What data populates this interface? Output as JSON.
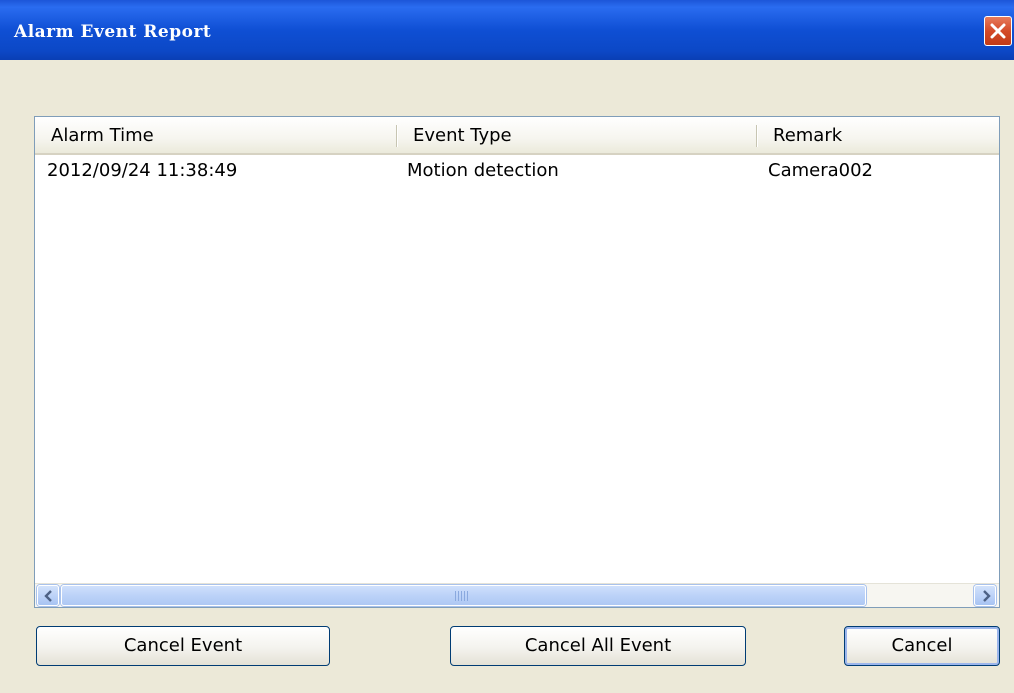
{
  "window": {
    "title": "Alarm Event Report",
    "close_icon": "close-icon",
    "close_color": "#d44a28",
    "title_bar_color": "#0f4fd4"
  },
  "table": {
    "columns": [
      "Alarm Time",
      "Event Type",
      "Remark"
    ],
    "rows": [
      {
        "alarm_time": "2012/09/24 11:38:49",
        "event_type": "Motion detection",
        "remark": "Camera002"
      }
    ]
  },
  "scrollbar": {
    "left_icon": "chevron-left-icon",
    "right_icon": "chevron-right-icon"
  },
  "buttons": {
    "cancel_event": "Cancel Event",
    "cancel_all_event": "Cancel All Event",
    "cancel": "Cancel"
  }
}
